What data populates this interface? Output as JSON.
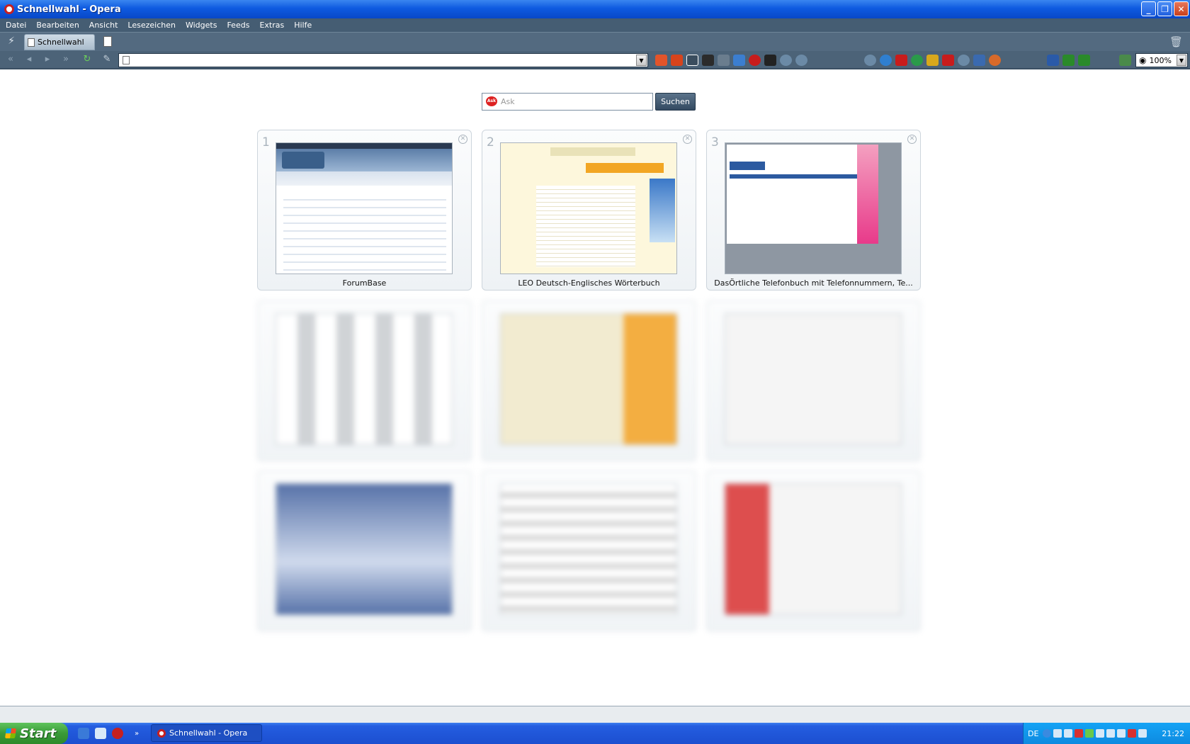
{
  "window": {
    "title": "Schnellwahl - Opera"
  },
  "menu": [
    "Datei",
    "Bearbeiten",
    "Ansicht",
    "Lesezeichen",
    "Widgets",
    "Feeds",
    "Extras",
    "Hilfe"
  ],
  "tabs": [
    {
      "label": "Schnellwahl"
    }
  ],
  "address": {
    "value": ""
  },
  "zoom": {
    "value": "100%"
  },
  "search": {
    "placeholder": "Ask",
    "button": "Suchen"
  },
  "speed_dial": [
    {
      "number": "1",
      "title": "ForumBase"
    },
    {
      "number": "2",
      "title": "LEO Deutsch-Englisches Wörterbuch"
    },
    {
      "number": "3",
      "title": "DasÖrtliche Telefonbuch mit Telefonnummern, Te..."
    }
  ],
  "taskbar": {
    "start": "Start",
    "task": "Schnellwahl - Opera",
    "lang": "DE",
    "clock": "21:22"
  },
  "colors": {
    "title_bar": "#0e5ae0",
    "chrome": "#455d73",
    "taskbar": "#245de0"
  }
}
